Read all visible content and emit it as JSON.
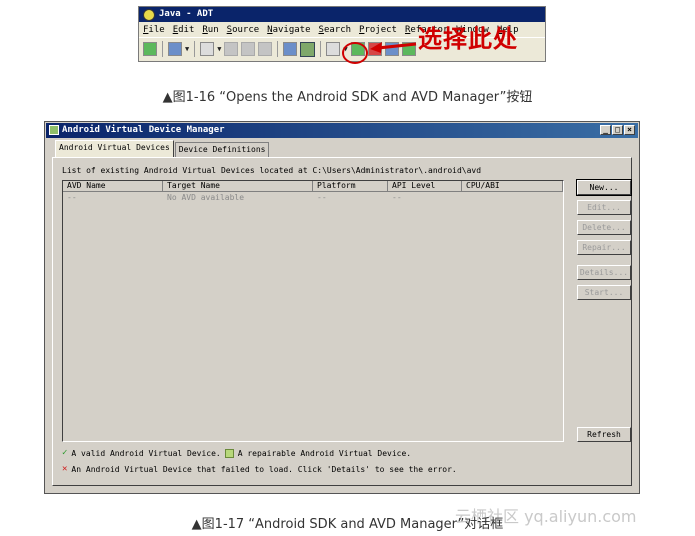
{
  "eclipse_window": {
    "title": "Java - ADT",
    "menu": [
      "File",
      "Edit",
      "Run",
      "Source",
      "Navigate",
      "Search",
      "Project",
      "Refactor",
      "Window",
      "Help"
    ],
    "annotation": "选择此处"
  },
  "captions": {
    "fig_1_16": "▲图1-16 “Opens the Android SDK and AVD Manager”按钮",
    "fig_1_17": "▲图1-17 “Android SDK and AVD Manager”对话框"
  },
  "dialog": {
    "title": "Android Virtual Device Manager",
    "tabs": [
      "Android Virtual Devices",
      "Device Definitions"
    ],
    "list_caption": "List of existing Android Virtual Devices located at C:\\Users\\Administrator\\.android\\avd",
    "columns": [
      "AVD Name",
      "Target Name",
      "Platform",
      "API Level",
      "CPU/ABI"
    ],
    "rows": [
      [
        "--",
        "No AVD available",
        "--",
        "--",
        ""
      ]
    ],
    "buttons": {
      "new": "New...",
      "edit": "Edit...",
      "delete": "Delete...",
      "repair": "Repair...",
      "details": "Details...",
      "start": "Start...",
      "refresh": "Refresh"
    },
    "legend": {
      "valid": "A valid Android Virtual Device.",
      "repairable": "A repairable Android Virtual Device.",
      "failed": "An Android Virtual Device that failed to load. Click 'Details' to see the error."
    }
  },
  "watermark": "云栖社区 yq.aliyun.com",
  "colors": {
    "annotation_red": "#d00000",
    "titlebar_blue": "#0a246a",
    "dialog_gray": "#d4d0c8"
  }
}
